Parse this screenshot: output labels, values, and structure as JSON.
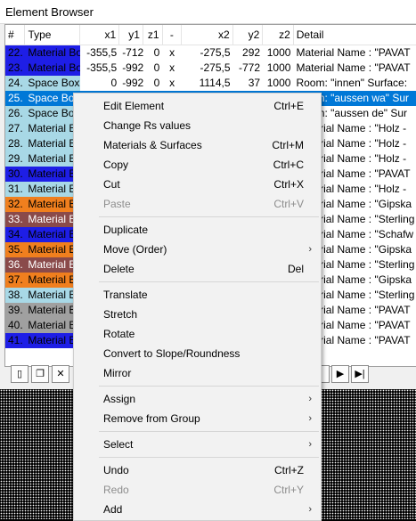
{
  "window": {
    "title": "Element Browser"
  },
  "table": {
    "columns": [
      "#",
      "Type",
      "x1",
      "y1",
      "z1",
      "-",
      "x2",
      "y2",
      "z2",
      "Detail"
    ],
    "rows": [
      {
        "num": "22.",
        "type": "Material Box",
        "x1": "-355,5",
        "y1": "-712",
        "z1": "0",
        "sep": "x",
        "x2": "-275,5",
        "y2": "292",
        "z2": "1000",
        "detail": "Material Name : \"PAVAT",
        "bg": "#1e1ee6",
        "fg": "#000",
        "selected": false
      },
      {
        "num": "23.",
        "type": "Material Box",
        "x1": "-355,5",
        "y1": "-992",
        "z1": "0",
        "sep": "x",
        "x2": "-275,5",
        "y2": "-772",
        "z2": "1000",
        "detail": "Material Name : \"PAVAT",
        "bg": "#1e1ee6",
        "fg": "#000",
        "selected": false
      },
      {
        "num": "24.",
        "type": "Space Box",
        "x1": "0",
        "y1": "-992",
        "z1": "0",
        "sep": "x",
        "x2": "1114,5",
        "y2": "37",
        "z2": "1000",
        "detail": "Room: \"innen\" Surface:",
        "bg": "#a8d8e6",
        "fg": "#000",
        "selected": false
      },
      {
        "num": "25.",
        "type": "Space Box",
        "x1": "",
        "y1": "",
        "z1": "",
        "sep": "",
        "x2": "",
        "y2": "",
        "z2": "",
        "detail": "Room: \"aussen wa\" Sur",
        "bg": "#a8d8e6",
        "fg": "#fff",
        "selected": true
      },
      {
        "num": "26.",
        "type": "Space Box",
        "x1": "",
        "y1": "",
        "z1": "",
        "sep": "",
        "x2": "",
        "y2": "",
        "z2": "",
        "detail": "Room: \"aussen de\" Sur",
        "bg": "#a8d8e6",
        "fg": "#000",
        "selected": false
      },
      {
        "num": "27.",
        "type": "Material B",
        "x1": "",
        "y1": "",
        "z1": "",
        "sep": "",
        "x2": "",
        "y2": "",
        "z2": "",
        "detail": "Material Name : \"Holz -",
        "bg": "#a8d8e6",
        "fg": "#000",
        "selected": false
      },
      {
        "num": "28.",
        "type": "Material B",
        "x1": "",
        "y1": "",
        "z1": "",
        "sep": "",
        "x2": "",
        "y2": "",
        "z2": "",
        "detail": "Material Name : \"Holz -",
        "bg": "#a8d8e6",
        "fg": "#000",
        "selected": false
      },
      {
        "num": "29.",
        "type": "Material B",
        "x1": "",
        "y1": "",
        "z1": "",
        "sep": "",
        "x2": "",
        "y2": "",
        "z2": "",
        "detail": "Material Name : \"Holz -",
        "bg": "#a8d8e6",
        "fg": "#000",
        "selected": false
      },
      {
        "num": "30.",
        "type": "Material B",
        "x1": "",
        "y1": "",
        "z1": "",
        "sep": "",
        "x2": "",
        "y2": "",
        "z2": "",
        "detail": "Material Name : \"PAVAT",
        "bg": "#1e1ee6",
        "fg": "#000",
        "selected": false
      },
      {
        "num": "31.",
        "type": "Material B",
        "x1": "",
        "y1": "",
        "z1": "",
        "sep": "",
        "x2": "",
        "y2": "",
        "z2": "",
        "detail": "Material Name : \"Holz -",
        "bg": "#a8d8e6",
        "fg": "#000",
        "selected": false
      },
      {
        "num": "32.",
        "type": "Material B",
        "x1": "",
        "y1": "",
        "z1": "",
        "sep": "",
        "x2": "",
        "y2": "",
        "z2": "",
        "detail": "Material Name : \"Gipska",
        "bg": "#f07f1e",
        "fg": "#000",
        "selected": false
      },
      {
        "num": "33.",
        "type": "Material B",
        "x1": "",
        "y1": "",
        "z1": "",
        "sep": "",
        "x2": "",
        "y2": "",
        "z2": "",
        "detail": "Material Name : \"Sterling",
        "bg": "#8a4a4a",
        "fg": "#fff",
        "selected": false
      },
      {
        "num": "34.",
        "type": "Material B",
        "x1": "",
        "y1": "",
        "z1": "",
        "sep": "",
        "x2": "",
        "y2": "",
        "z2": "",
        "detail": "Material Name : \"Schafw",
        "bg": "#1e1ee6",
        "fg": "#000",
        "selected": false
      },
      {
        "num": "35.",
        "type": "Material B",
        "x1": "",
        "y1": "",
        "z1": "",
        "sep": "",
        "x2": "",
        "y2": "",
        "z2": "",
        "detail": "Material Name : \"Gipska",
        "bg": "#f07f1e",
        "fg": "#000",
        "selected": false
      },
      {
        "num": "36.",
        "type": "Material B",
        "x1": "",
        "y1": "",
        "z1": "",
        "sep": "",
        "x2": "",
        "y2": "",
        "z2": "",
        "detail": "Material Name : \"Sterling",
        "bg": "#8a4a4a",
        "fg": "#fff",
        "selected": false
      },
      {
        "num": "37.",
        "type": "Material B",
        "x1": "",
        "y1": "",
        "z1": "",
        "sep": "",
        "x2": "",
        "y2": "",
        "z2": "",
        "detail": "Material Name : \"Gipska",
        "bg": "#f07f1e",
        "fg": "#000",
        "selected": false
      },
      {
        "num": "38.",
        "type": "Material B",
        "x1": "",
        "y1": "",
        "z1": "",
        "sep": "",
        "x2": "",
        "y2": "",
        "z2": "",
        "detail": "Material Name : \"Sterling",
        "bg": "#a8d8e6",
        "fg": "#000",
        "selected": false
      },
      {
        "num": "39.",
        "type": "Material B",
        "x1": "",
        "y1": "",
        "z1": "",
        "sep": "",
        "x2": "",
        "y2": "",
        "z2": "",
        "detail": "Material Name : \"PAVAT",
        "bg": "#a0a0a0",
        "fg": "#000",
        "selected": false
      },
      {
        "num": "40.",
        "type": "Material B",
        "x1": "",
        "y1": "",
        "z1": "",
        "sep": "",
        "x2": "",
        "y2": "",
        "z2": "",
        "detail": "Material Name : \"PAVAT",
        "bg": "#a0a0a0",
        "fg": "#000",
        "selected": false
      },
      {
        "num": "41.",
        "type": "Material B",
        "x1": "",
        "y1": "",
        "z1": "",
        "sep": "",
        "x2": "",
        "y2": "",
        "z2": "",
        "detail": "Material Name : \"PAVAT",
        "bg": "#1e1ee6",
        "fg": "#000",
        "selected": false
      }
    ]
  },
  "toolbar": {
    "buttons": [
      {
        "name": "new-element-button",
        "icon": "▯",
        "label": ""
      },
      {
        "name": "copy-element-button",
        "icon": "❐",
        "label": ""
      },
      {
        "name": "delete-element-button",
        "icon": "✕",
        "label": ""
      }
    ],
    "nav": [
      {
        "name": "nav-button-blank",
        "icon": ""
      },
      {
        "name": "nav-next-button",
        "icon": "▶"
      },
      {
        "name": "nav-last-button",
        "icon": "▶|"
      }
    ]
  },
  "context_menu": {
    "groups": [
      [
        {
          "label": "Edit Element",
          "shortcut": "Ctrl+E",
          "disabled": false,
          "submenu": false
        },
        {
          "label": "Change Rs values",
          "shortcut": "",
          "disabled": false,
          "submenu": false
        },
        {
          "label": "Materials & Surfaces",
          "shortcut": "Ctrl+M",
          "disabled": false,
          "submenu": false
        },
        {
          "label": "Copy",
          "shortcut": "Ctrl+C",
          "disabled": false,
          "submenu": false
        },
        {
          "label": "Cut",
          "shortcut": "Ctrl+X",
          "disabled": false,
          "submenu": false
        },
        {
          "label": "Paste",
          "shortcut": "Ctrl+V",
          "disabled": true,
          "submenu": false
        }
      ],
      [
        {
          "label": "Duplicate",
          "shortcut": "",
          "disabled": false,
          "submenu": false
        },
        {
          "label": "Move (Order)",
          "shortcut": "",
          "disabled": false,
          "submenu": true
        },
        {
          "label": "Delete",
          "shortcut": "Del",
          "disabled": false,
          "submenu": false
        }
      ],
      [
        {
          "label": "Translate",
          "shortcut": "",
          "disabled": false,
          "submenu": false
        },
        {
          "label": "Stretch",
          "shortcut": "",
          "disabled": false,
          "submenu": false
        },
        {
          "label": "Rotate",
          "shortcut": "",
          "disabled": false,
          "submenu": false
        },
        {
          "label": "Convert to Slope/Roundness",
          "shortcut": "",
          "disabled": false,
          "submenu": false
        },
        {
          "label": "Mirror",
          "shortcut": "",
          "disabled": false,
          "submenu": false
        }
      ],
      [
        {
          "label": "Assign",
          "shortcut": "",
          "disabled": false,
          "submenu": true
        },
        {
          "label": "Remove from Group",
          "shortcut": "",
          "disabled": false,
          "submenu": true
        }
      ],
      [
        {
          "label": "Select",
          "shortcut": "",
          "disabled": false,
          "submenu": true
        }
      ],
      [
        {
          "label": "Undo",
          "shortcut": "Ctrl+Z",
          "disabled": false,
          "submenu": false
        },
        {
          "label": "Redo",
          "shortcut": "Ctrl+Y",
          "disabled": true,
          "submenu": false
        },
        {
          "label": "Add",
          "shortcut": "",
          "disabled": false,
          "submenu": true
        }
      ]
    ]
  },
  "colors": {
    "selection": "#0078d7",
    "material_blue": "#1e1ee6",
    "space_light_blue": "#a8d8e6",
    "material_orange": "#f07f1e",
    "material_brown": "#8a4a4a",
    "material_gray": "#a0a0a0"
  }
}
